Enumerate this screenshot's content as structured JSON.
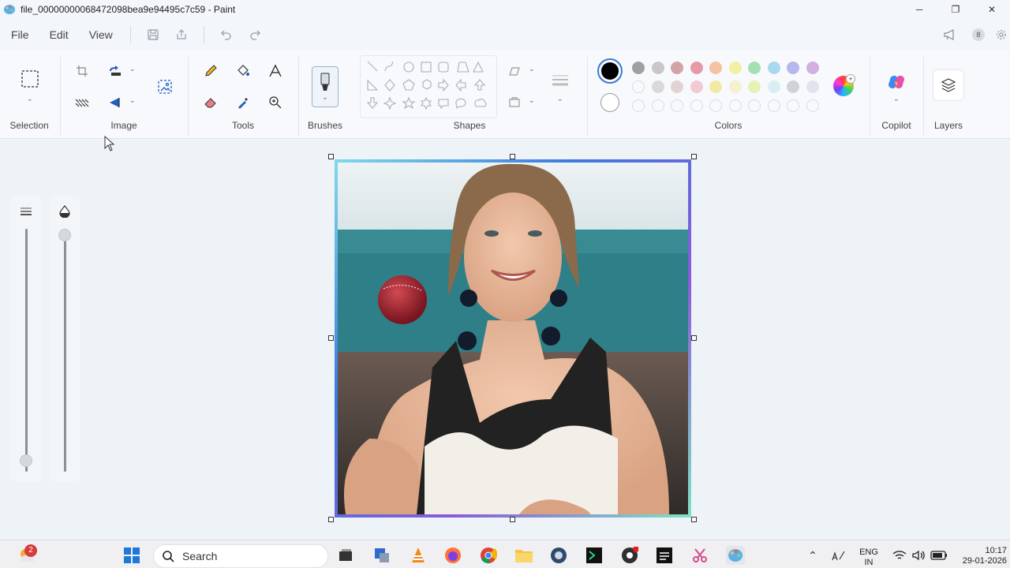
{
  "window": {
    "title": "file_00000000068472098bea9e94495c7c59 - Paint",
    "controls": {
      "minimize": "─",
      "maximize": "❐",
      "close": "✕"
    }
  },
  "menu": {
    "items": [
      "File",
      "Edit",
      "View"
    ],
    "avatar_initial": "8"
  },
  "ribbon": {
    "groups": {
      "selection": "Selection",
      "image": "Image",
      "tools": "Tools",
      "brushes": "Brushes",
      "shapes": "Shapes",
      "colors": "Colors",
      "copilot": "Copilot",
      "layers": "Layers"
    },
    "colors": {
      "primary": "#000000",
      "secondary": "#ffffff",
      "row1": [
        "#a0a0a0",
        "#c8c8c8",
        "#d3a3a8",
        "#e79aa6",
        "#f3c2a3",
        "#f2f0a4",
        "#a7dfb4",
        "#a9d9ee",
        "#b4b8ea",
        "#d1b0e0"
      ],
      "row2": [
        "",
        "#d9d9d9",
        "#e1d3d5",
        "#f0cbd3",
        "#f2eaa4",
        "#f4f1cf",
        "#e3f3b8",
        "#d9eef3",
        "#cfd3d8",
        "#e3e3ef"
      ]
    }
  },
  "taskbar": {
    "search_label": "Search",
    "notification_count": "2",
    "language": "ENG",
    "region": "IN",
    "time": "10:17",
    "date": "29-01-2026"
  }
}
